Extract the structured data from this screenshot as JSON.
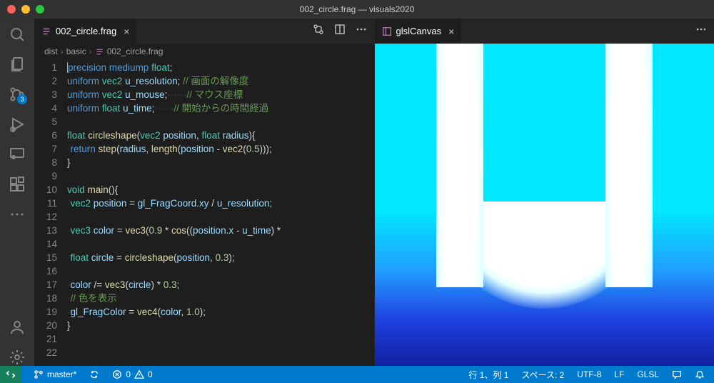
{
  "window": {
    "title": "002_circle.frag — visuals2020"
  },
  "activitybar": {
    "scm_badge": "3"
  },
  "editor_left": {
    "tab_label": "002_circle.frag",
    "breadcrumbs": {
      "p0": "dist",
      "p1": "basic",
      "p2": "002_circle.frag"
    },
    "actions": {
      "compare": "compare-changes",
      "split": "split-editor",
      "more": "more"
    }
  },
  "editor_right": {
    "tab_label": "glslCanvas"
  },
  "code": {
    "lines": [
      {
        "n": "1",
        "seg": [
          [
            "kw",
            "precision"
          ],
          [
            "pn",
            " "
          ],
          [
            "kw",
            "mediump"
          ],
          [
            "pn",
            " "
          ],
          [
            "ty",
            "float"
          ],
          [
            "pn",
            ";"
          ]
        ],
        "cursor": true
      },
      {
        "n": "2",
        "seg": [
          [
            "kw",
            "uniform"
          ],
          [
            "pn",
            " "
          ],
          [
            "ty",
            "vec2"
          ],
          [
            "pn",
            " "
          ],
          [
            "id",
            "u_resolution"
          ],
          [
            "pn",
            "; "
          ],
          [
            "cm",
            "// 画面の解像度"
          ]
        ]
      },
      {
        "n": "3",
        "seg": [
          [
            "kw",
            "uniform"
          ],
          [
            "pn",
            " "
          ],
          [
            "ty",
            "vec2"
          ],
          [
            "pn",
            " "
          ],
          [
            "id",
            "u_mouse"
          ],
          [
            "pn",
            ";"
          ],
          [
            "ws",
            "······"
          ],
          [
            "cm",
            "// マウス座標"
          ]
        ]
      },
      {
        "n": "4",
        "seg": [
          [
            "kw",
            "uniform"
          ],
          [
            "pn",
            " "
          ],
          [
            "ty",
            "float"
          ],
          [
            "pn",
            " "
          ],
          [
            "id",
            "u_time"
          ],
          [
            "pn",
            ";"
          ],
          [
            "ws",
            "······"
          ],
          [
            "cm",
            "// 開始からの時間経過"
          ]
        ]
      },
      {
        "n": "5",
        "seg": []
      },
      {
        "n": "6",
        "seg": [
          [
            "ty",
            "float"
          ],
          [
            "pn",
            " "
          ],
          [
            "fn",
            "circleshape"
          ],
          [
            "pn",
            "("
          ],
          [
            "ty",
            "vec2"
          ],
          [
            "pn",
            " "
          ],
          [
            "id",
            "position"
          ],
          [
            "pn",
            ", "
          ],
          [
            "ty",
            "float"
          ],
          [
            "pn",
            " "
          ],
          [
            "id",
            "radius"
          ],
          [
            "pn",
            "){"
          ]
        ]
      },
      {
        "n": "7",
        "seg": [
          [
            "ws",
            "·"
          ],
          [
            "kw",
            "return"
          ],
          [
            "pn",
            " "
          ],
          [
            "fn",
            "step"
          ],
          [
            "pn",
            "("
          ],
          [
            "id",
            "radius"
          ],
          [
            "pn",
            ", "
          ],
          [
            "fn",
            "length"
          ],
          [
            "pn",
            "("
          ],
          [
            "id",
            "position"
          ],
          [
            "pn",
            " - "
          ],
          [
            "fn",
            "vec2"
          ],
          [
            "pn",
            "("
          ],
          [
            "nm",
            "0.5"
          ],
          [
            "pn",
            ")));"
          ]
        ]
      },
      {
        "n": "8",
        "seg": [
          [
            "pn",
            "}"
          ]
        ]
      },
      {
        "n": "9",
        "seg": []
      },
      {
        "n": "10",
        "seg": [
          [
            "ty",
            "void"
          ],
          [
            "pn",
            " "
          ],
          [
            "fn",
            "main"
          ],
          [
            "pn",
            "(){"
          ]
        ]
      },
      {
        "n": "11",
        "seg": [
          [
            "ws",
            "·"
          ],
          [
            "ty",
            "vec2"
          ],
          [
            "pn",
            " "
          ],
          [
            "id",
            "position"
          ],
          [
            "pn",
            " = "
          ],
          [
            "id",
            "gl_FragCoord"
          ],
          [
            "pn",
            "."
          ],
          [
            "id",
            "xy"
          ],
          [
            "pn",
            " / "
          ],
          [
            "id",
            "u_resolution"
          ],
          [
            "pn",
            ";"
          ]
        ]
      },
      {
        "n": "12",
        "seg": []
      },
      {
        "n": "13",
        "seg": [
          [
            "ws",
            "·"
          ],
          [
            "ty",
            "vec3"
          ],
          [
            "pn",
            " "
          ],
          [
            "id",
            "color"
          ],
          [
            "pn",
            " = "
          ],
          [
            "fn",
            "vec3"
          ],
          [
            "pn",
            "("
          ],
          [
            "nm",
            "0.9"
          ],
          [
            "pn",
            " * "
          ],
          [
            "fn",
            "cos"
          ],
          [
            "pn",
            "(("
          ],
          [
            "id",
            "position"
          ],
          [
            "pn",
            "."
          ],
          [
            "id",
            "x"
          ],
          [
            "pn",
            " - "
          ],
          [
            "id",
            "u_time"
          ],
          [
            "pn",
            ") *"
          ]
        ]
      },
      {
        "n": "14",
        "seg": []
      },
      {
        "n": "15",
        "seg": [
          [
            "ws",
            "·"
          ],
          [
            "ty",
            "float"
          ],
          [
            "pn",
            " "
          ],
          [
            "id",
            "circle"
          ],
          [
            "pn",
            " = "
          ],
          [
            "fn",
            "circleshape"
          ],
          [
            "pn",
            "("
          ],
          [
            "id",
            "position"
          ],
          [
            "pn",
            ", "
          ],
          [
            "nm",
            "0.3"
          ],
          [
            "pn",
            ");"
          ]
        ]
      },
      {
        "n": "16",
        "seg": []
      },
      {
        "n": "17",
        "seg": [
          [
            "ws",
            "·"
          ],
          [
            "id",
            "color"
          ],
          [
            "pn",
            " /= "
          ],
          [
            "fn",
            "vec3"
          ],
          [
            "pn",
            "("
          ],
          [
            "id",
            "circle"
          ],
          [
            "pn",
            ") * "
          ],
          [
            "nm",
            "0.3"
          ],
          [
            "pn",
            ";"
          ]
        ]
      },
      {
        "n": "18",
        "seg": [
          [
            "ws",
            "·"
          ],
          [
            "cm",
            "// 色を表示"
          ]
        ]
      },
      {
        "n": "19",
        "seg": [
          [
            "ws",
            "·"
          ],
          [
            "id",
            "gl_FragColor"
          ],
          [
            "pn",
            " = "
          ],
          [
            "fn",
            "vec4"
          ],
          [
            "pn",
            "("
          ],
          [
            "id",
            "color"
          ],
          [
            "pn",
            ", "
          ],
          [
            "nm",
            "1.0"
          ],
          [
            "pn",
            ");"
          ]
        ]
      },
      {
        "n": "20",
        "seg": [
          [
            "pn",
            "}"
          ]
        ]
      },
      {
        "n": "21",
        "seg": []
      },
      {
        "n": "22",
        "seg": []
      }
    ]
  },
  "statusbar": {
    "branch": "master*",
    "errors": "0",
    "warnings": "0",
    "cursor": "行 1、列 1",
    "spaces": "スペース: 2",
    "encoding": "UTF-8",
    "eol": "LF",
    "language": "GLSL"
  }
}
